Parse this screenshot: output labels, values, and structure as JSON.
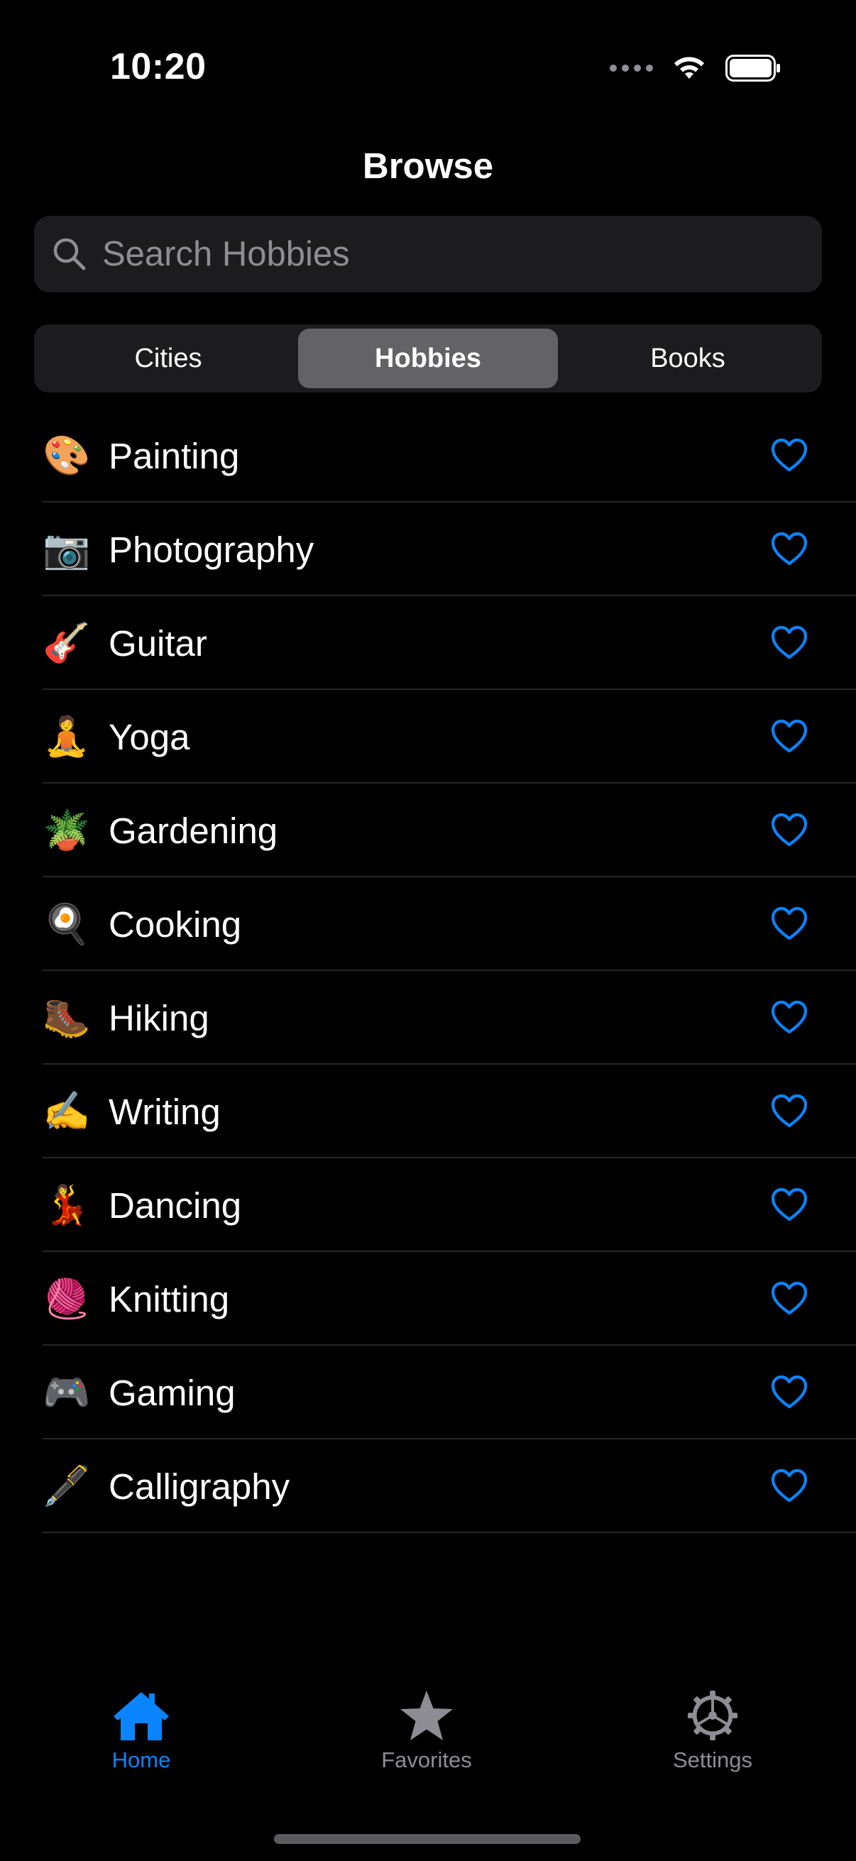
{
  "status_bar": {
    "time": "10:20"
  },
  "nav": {
    "title": "Browse"
  },
  "search": {
    "placeholder": "Search Hobbies",
    "value": ""
  },
  "segments": [
    {
      "label": "Cities",
      "selected": false
    },
    {
      "label": "Hobbies",
      "selected": true
    },
    {
      "label": "Books",
      "selected": false
    }
  ],
  "hobbies": [
    {
      "emoji": "🎨",
      "label": "Painting",
      "favorite": false
    },
    {
      "emoji": "📷",
      "label": "Photography",
      "favorite": false
    },
    {
      "emoji": "🎸",
      "label": "Guitar",
      "favorite": false
    },
    {
      "emoji": "🧘",
      "label": "Yoga",
      "favorite": false
    },
    {
      "emoji": "🪴",
      "label": "Gardening",
      "favorite": false
    },
    {
      "emoji": "🍳",
      "label": "Cooking",
      "favorite": false
    },
    {
      "emoji": "🥾",
      "label": "Hiking",
      "favorite": false
    },
    {
      "emoji": "✍️",
      "label": "Writing",
      "favorite": false
    },
    {
      "emoji": "💃",
      "label": "Dancing",
      "favorite": false
    },
    {
      "emoji": "🧶",
      "label": "Knitting",
      "favorite": false
    },
    {
      "emoji": "🎮",
      "label": "Gaming",
      "favorite": false
    },
    {
      "emoji": "🖋️",
      "label": "Calligraphy",
      "favorite": false
    }
  ],
  "tabbar": {
    "home_label": "Home",
    "favorites_label": "Favorites",
    "settings_label": "Settings",
    "active": "Home"
  },
  "colors": {
    "accent": "#0a84ff",
    "background": "#000000",
    "surface": "#1c1c1e",
    "segment_selected": "#636366",
    "secondary_text": "#8d8d93"
  },
  "icons": {
    "row_action": "heart-outline-icon",
    "tab_home": "house-fill-icon",
    "tab_favorites": "star-fill-icon",
    "tab_settings": "gear-icon"
  }
}
